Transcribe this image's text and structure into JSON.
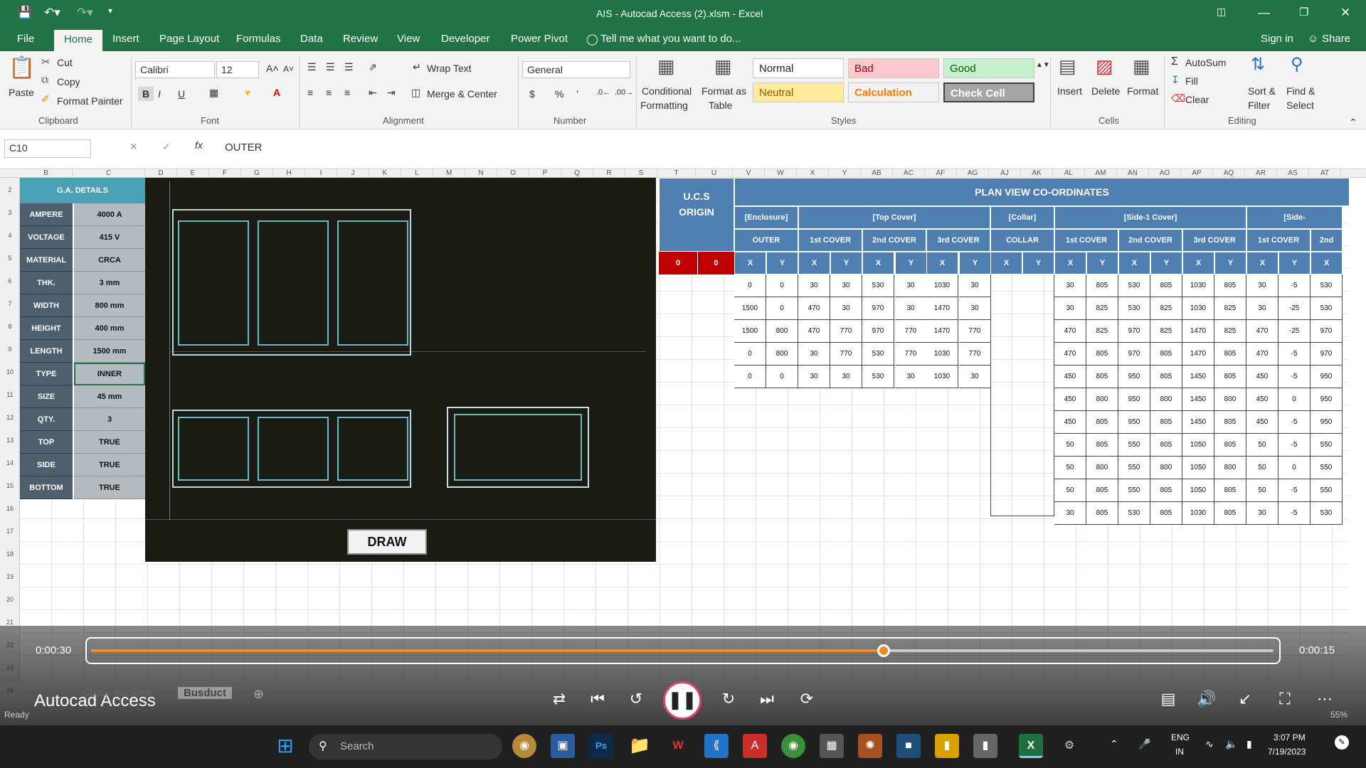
{
  "window": {
    "title": "AIS - Autocad Access (2).xlsm - Excel"
  },
  "menu": {
    "tabs": [
      "File",
      "Home",
      "Insert",
      "Page Layout",
      "Formulas",
      "Data",
      "Review",
      "View",
      "Developer",
      "Power Pivot"
    ],
    "tell_me": "Tell me what you want to do...",
    "sign_in": "Sign in",
    "share": "Share"
  },
  "ribbon": {
    "clipboard": {
      "paste": "Paste",
      "cut": "Cut",
      "copy": "Copy",
      "format_painter": "Format Painter",
      "group": "Clipboard"
    },
    "font": {
      "name": "Calibri",
      "size": "12",
      "group": "Font"
    },
    "alignment": {
      "wrap": "Wrap Text",
      "merge": "Merge & Center",
      "group": "Alignment"
    },
    "number": {
      "format": "General",
      "group": "Number"
    },
    "styles": {
      "cond1": "Conditional",
      "cond2": "Formatting",
      "table1": "Format as",
      "table2": "Table",
      "normal": "Normal",
      "bad": "Bad",
      "good": "Good",
      "neutral": "Neutral",
      "calculation": "Calculation",
      "check": "Check Cell",
      "group": "Styles"
    },
    "cells": {
      "insert": "Insert",
      "delete": "Delete",
      "format": "Format",
      "group": "Cells"
    },
    "editing": {
      "autosum": "AutoSum",
      "fill": "Fill",
      "clear": "Clear",
      "sort1": "Sort &",
      "sort2": "Filter",
      "find1": "Find &",
      "find2": "Select",
      "group": "Editing"
    }
  },
  "formula_bar": {
    "name_box": "C10",
    "formula": "OUTER"
  },
  "columns": [
    "B",
    "C",
    "D",
    "E",
    "F",
    "G",
    "H",
    "I",
    "J",
    "K",
    "L",
    "M",
    "N",
    "O",
    "P",
    "Q",
    "R",
    "S",
    "T",
    "U",
    "V",
    "W",
    "X",
    "Y",
    "AB",
    "AC",
    "AF",
    "AG",
    "AJ",
    "AK",
    "AL",
    "AM",
    "AN",
    "AO",
    "AP",
    "AQ",
    "AR",
    "AS",
    "AT"
  ],
  "rows": [
    "2",
    "3",
    "4",
    "5",
    "6",
    "7",
    "8",
    "9",
    "10",
    "11",
    "12",
    "13",
    "14",
    "15",
    "16",
    "17",
    "18",
    "19",
    "20",
    "21",
    "22",
    "23",
    "24"
  ],
  "ga": {
    "title": "G.A. DETAILS",
    "items": [
      {
        "label": "AMPERE",
        "value": "4000 A"
      },
      {
        "label": "VOLTAGE",
        "value": "415 V"
      },
      {
        "label": "MATERIAL",
        "value": "CRCA"
      },
      {
        "label": "THK.",
        "value": "3 mm"
      },
      {
        "label": "WIDTH",
        "value": "800 mm"
      },
      {
        "label": "HEIGHT",
        "value": "400 mm"
      },
      {
        "label": "LENGTH",
        "value": "1500 mm"
      },
      {
        "label": "TYPE",
        "value": "INNER"
      },
      {
        "label": "SIZE",
        "value": "45 mm"
      },
      {
        "label": "QTY.",
        "value": "3"
      },
      {
        "label": "TOP",
        "value": "TRUE"
      },
      {
        "label": "SIDE",
        "value": "TRUE"
      },
      {
        "label": "BOTTOM",
        "value": "TRUE"
      }
    ],
    "draw": "DRAW"
  },
  "ucs": {
    "title1": "U.C.S",
    "title2": "ORIGIN",
    "x": "0",
    "y": "0"
  },
  "plan": {
    "title": "PLAN VIEW CO-ORDINATES",
    "groups": [
      "[Enclosure]",
      "[Top Cover]",
      "[Collar]",
      "[Side-1 Cover]",
      "[Side-"
    ],
    "sub": [
      "OUTER",
      "1st COVER",
      "2nd COVER",
      "3rd COVER",
      "COLLAR",
      "1st COVER",
      "2nd COVER",
      "3rd COVER",
      "1st COVER",
      "2nd"
    ],
    "xy": [
      "X",
      "Y",
      "X",
      "Y",
      "X",
      "Y",
      "X",
      "Y",
      "X",
      "Y",
      "X",
      "Y",
      "X",
      "Y",
      "X",
      "Y",
      "X",
      "Y",
      "X"
    ],
    "enc": [
      [
        "0",
        "0",
        "30",
        "30",
        "530",
        "30",
        "1030",
        "30"
      ],
      [
        "1500",
        "0",
        "470",
        "30",
        "970",
        "30",
        "1470",
        "30"
      ],
      [
        "1500",
        "800",
        "470",
        "770",
        "970",
        "770",
        "1470",
        "770"
      ],
      [
        "0",
        "800",
        "30",
        "770",
        "530",
        "770",
        "1030",
        "770"
      ],
      [
        "0",
        "0",
        "30",
        "30",
        "530",
        "30",
        "1030",
        "30"
      ]
    ],
    "side": [
      [
        "30",
        "805",
        "530",
        "805",
        "1030",
        "805",
        "30",
        "-5",
        "530"
      ],
      [
        "30",
        "825",
        "530",
        "825",
        "1030",
        "825",
        "30",
        "-25",
        "530"
      ],
      [
        "470",
        "825",
        "970",
        "825",
        "1470",
        "825",
        "470",
        "-25",
        "970"
      ],
      [
        "470",
        "805",
        "970",
        "805",
        "1470",
        "805",
        "470",
        "-5",
        "970"
      ],
      [
        "450",
        "805",
        "950",
        "805",
        "1450",
        "805",
        "450",
        "-5",
        "950"
      ],
      [
        "450",
        "800",
        "950",
        "800",
        "1450",
        "800",
        "450",
        "0",
        "950"
      ],
      [
        "450",
        "805",
        "950",
        "805",
        "1450",
        "805",
        "450",
        "-5",
        "950"
      ],
      [
        "50",
        "805",
        "550",
        "805",
        "1050",
        "805",
        "50",
        "-5",
        "550"
      ],
      [
        "50",
        "800",
        "550",
        "800",
        "1050",
        "800",
        "50",
        "0",
        "550"
      ],
      [
        "50",
        "805",
        "550",
        "805",
        "1050",
        "805",
        "50",
        "-5",
        "550"
      ],
      [
        "30",
        "805",
        "530",
        "805",
        "1030",
        "805",
        "30",
        "-5",
        "530"
      ]
    ]
  },
  "sheets": {
    "tab1": "Cross-sections",
    "tab2": "Busduct",
    "status": "Ready",
    "zoom": "55%"
  },
  "player": {
    "elapsed": "0:00:30",
    "remaining": "0:00:15",
    "progress": 0.67,
    "title": "Autocad Access"
  },
  "taskbar": {
    "search": "Search",
    "lang1": "ENG",
    "lang2": "IN",
    "time": "3:07 PM",
    "date": "7/19/2023"
  }
}
